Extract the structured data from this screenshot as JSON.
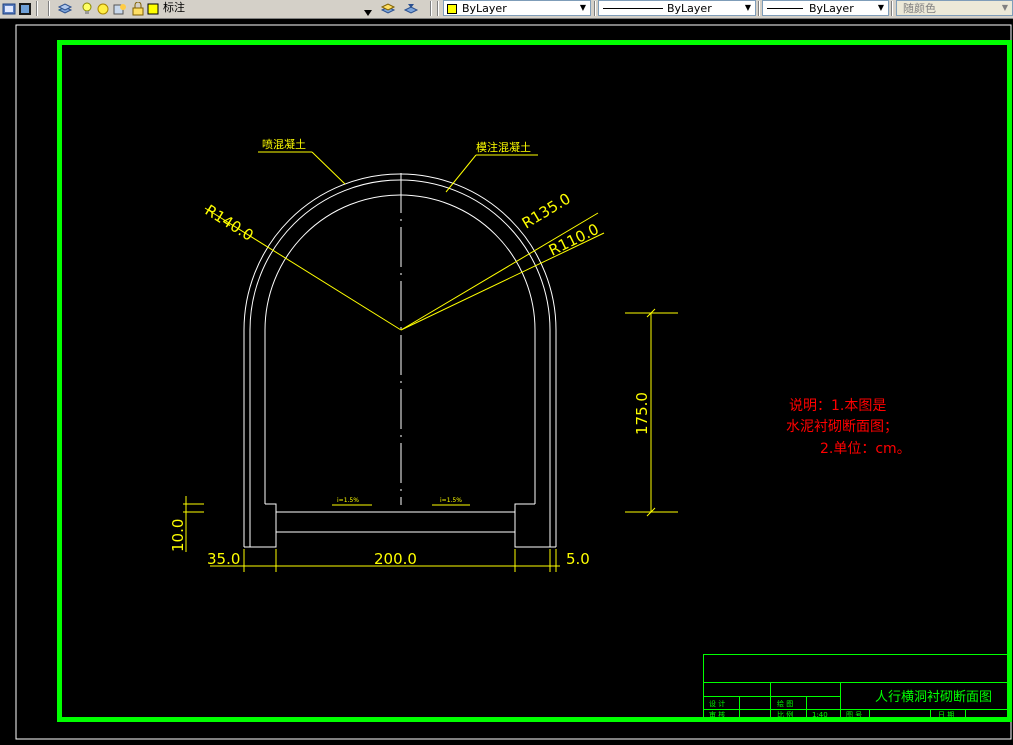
{
  "toolbar": {
    "text_style": "标注",
    "color_control": "ByLayer",
    "linetype_control": "ByLayer",
    "lineweight_control": "ByLayer",
    "plot_style": "随颜色"
  },
  "drawing": {
    "label_shotcrete": "喷混凝土",
    "label_cast_concrete": "模注混凝土",
    "radius_outer": "R140.0",
    "radius_mid": "R135.0",
    "radius_inner": "R110.0",
    "dim_height": "175.0",
    "dim_width": "200.0",
    "dim_left": "35.0",
    "dim_right": "5.0",
    "dim_floor": "10.0",
    "slope_left": "i=1.5%",
    "slope_right": "i=1.5%",
    "note_line1": "说明：1.本图是",
    "note_line2": "水泥衬砌断面图；",
    "note_line3": "2.单位：cm。"
  },
  "title_block": {
    "title": "人行横洞衬砌断面图",
    "design": "设 计",
    "drawing": "绘 图",
    "review": "审 核",
    "scale_label": "比 例",
    "scale_value": "1:40",
    "drawing_no": "图 号",
    "date": "日 期"
  },
  "colors": {
    "frame": "#00ff00",
    "dimension": "#ffff00",
    "geometry": "#ffffff",
    "note": "#ff0000"
  }
}
